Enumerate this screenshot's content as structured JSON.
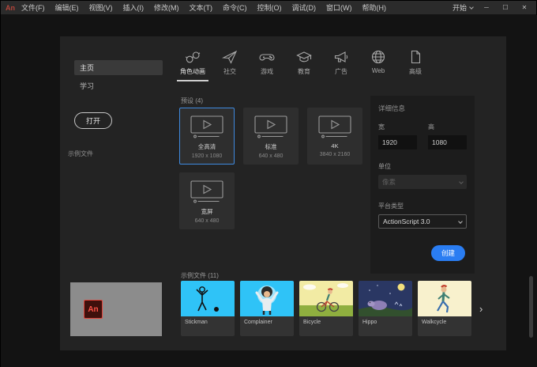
{
  "titlebar": {
    "logo": "An",
    "menus": [
      "文件(F)",
      "编辑(E)",
      "视图(V)",
      "插入(I)",
      "修改(M)",
      "文本(T)",
      "命令(C)",
      "控制(O)",
      "调试(D)",
      "窗口(W)",
      "帮助(H)"
    ],
    "start_label": "开始",
    "window_controls": {
      "minimize": "─",
      "maximize": "☐",
      "close": "✕"
    }
  },
  "sidebar": {
    "home": "主页",
    "learn": "学习",
    "open_button": "打开",
    "samples_link": "示例文件"
  },
  "tabs": [
    {
      "label": "角色动画",
      "icon": "goggles-icon"
    },
    {
      "label": "社交",
      "icon": "paper-plane-icon"
    },
    {
      "label": "游戏",
      "icon": "game-controller-icon"
    },
    {
      "label": "教育",
      "icon": "graduation-cap-icon"
    },
    {
      "label": "广告",
      "icon": "megaphone-icon"
    },
    {
      "label": "Web",
      "icon": "globe-icon"
    },
    {
      "label": "高级",
      "icon": "document-icon"
    }
  ],
  "presets": {
    "header": "预设 (4)",
    "cards": [
      {
        "name": "全高清",
        "size": "1920 x 1080",
        "selected": true
      },
      {
        "name": "标准",
        "size": "640 x 480",
        "selected": false
      },
      {
        "name": "4K",
        "size": "3840 x 2160",
        "selected": false
      },
      {
        "name": "宽屏",
        "size": "640 x 480",
        "selected": false
      }
    ]
  },
  "details": {
    "header": "详细信息",
    "width_label": "宽",
    "width_value": "1920",
    "height_label": "高",
    "height_value": "1080",
    "unit_label": "单位",
    "unit_value": "像素",
    "platform_label": "平台类型",
    "platform_value": "ActionScript 3.0",
    "create_button": "创建"
  },
  "samples": {
    "header": "示例文件 (11)",
    "items": [
      "Stickman",
      "Complainer",
      "Bicycle",
      "Hippo",
      "Walkcycle"
    ],
    "next_chevron": "›"
  },
  "colors": {
    "accent_blue": "#2a7df2",
    "selection_border": "#3f8ae0",
    "brand_red": "#ff5347"
  }
}
